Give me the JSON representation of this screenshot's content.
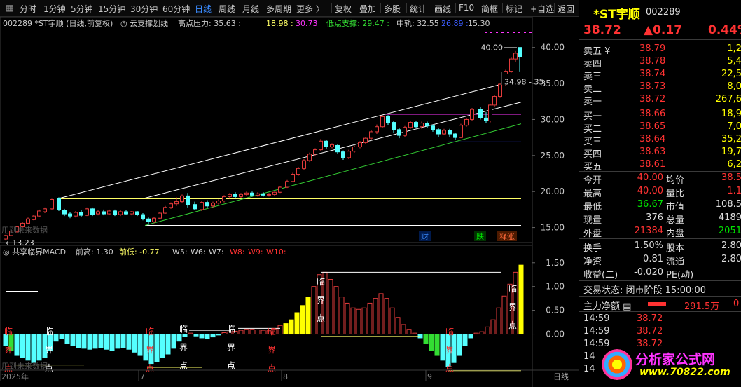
{
  "toolbar": {
    "left_items": [
      "分时",
      "1分钟",
      "5分钟",
      "15分钟",
      "30分钟",
      "60分钟",
      "日线",
      "周线",
      "月线",
      "多周期",
      "更多 〉"
    ],
    "active_item": "日线",
    "right_items": [
      "复权",
      "叠加",
      "多股",
      "统计",
      "画线",
      "F10",
      "简框",
      "标记",
      "+自选",
      "返回"
    ]
  },
  "main_chart": {
    "info": {
      "code": "002289",
      "name": "*ST宇顺",
      "period": "(日线,前复权)",
      "indicator_name": "云支撑划线",
      "high_pressure_label": "高点压力:",
      "high_pressure_values": [
        "35.63",
        "18.98",
        "30.73"
      ],
      "low_support_label": "低点支撑:",
      "low_support_value": "29.47",
      "mid_rail_label": "中轨:",
      "mid_rail_values": [
        "32.55",
        "26.89",
        "15.30"
      ]
    },
    "y_ticks": [
      "40.00",
      "35.00",
      "30.00",
      "25.00",
      "20.00",
      "15.00"
    ],
    "y_range": [
      13.5,
      42.5
    ],
    "annotations": {
      "top_price": "40.00",
      "channel_label": "34.98 - 35",
      "low_price": "←13.23",
      "footer_note": "用到未来数据"
    },
    "badges": [
      {
        "text": "财",
        "color": "#3b8cff"
      },
      {
        "text": "跌",
        "color": "#00e600"
      },
      {
        "text": "释涨",
        "color": "#ff6a3a"
      }
    ],
    "colors": {
      "up": "#e33b3b",
      "down": "#55ffff",
      "boll_upper": "#ffffff",
      "support": "#33cc33",
      "yellow_line": "#ffff66",
      "magenta": "#ff33ff",
      "blue": "#3344ff"
    }
  },
  "sub_chart": {
    "info": {
      "indicator_name": "共享临界MACD",
      "prev_high_label": "前高:",
      "prev_high_value": "1.30",
      "prev_low_label": "前低:",
      "prev_low_value": "-0.77",
      "w_labels": [
        "W5:",
        "W6:",
        "W7:",
        "W8:",
        "W9:",
        "W10:"
      ]
    },
    "y_ticks": [
      "1.50",
      "1.00",
      "0.50",
      "0.00"
    ],
    "y_range": [
      -0.7,
      1.6
    ],
    "footer_note": "用到未来数据",
    "vertical_labels": [
      {
        "chars": [
          "临",
          "界",
          "点"
        ],
        "color": "#ffffff"
      },
      {
        "chars": [
          "临",
          "界",
          "点"
        ],
        "color": "#ff3232"
      }
    ],
    "critical_words": {
      "lin": "临",
      "jie": "界",
      "dian": "点"
    }
  },
  "x_axis": {
    "labels": [
      "2025年",
      "7",
      "8",
      "9"
    ],
    "period_button": "日线"
  },
  "quote_panel": {
    "title": "*ST宇顺",
    "code": "002289",
    "price": "38.72",
    "change": "▲0.17",
    "change_pct": "0.44%",
    "asks": [
      {
        "label": "卖五 ¥",
        "price": "38.79",
        "vol": "1,2"
      },
      {
        "label": "卖四",
        "price": "38.78",
        "vol": "5,4"
      },
      {
        "label": "卖三",
        "price": "38.74",
        "vol": "22,5"
      },
      {
        "label": "卖二",
        "price": "38.73",
        "vol": "8,0"
      },
      {
        "label": "卖一",
        "price": "38.72",
        "vol": "267,6"
      }
    ],
    "bids": [
      {
        "label": "买一",
        "price": "38.66",
        "vol": "18,9"
      },
      {
        "label": "买二",
        "price": "38.65",
        "vol": "7,0"
      },
      {
        "label": "买三",
        "price": "38.64",
        "vol": "35,2"
      },
      {
        "label": "买四",
        "price": "38.63",
        "vol": "19,7"
      },
      {
        "label": "买五",
        "price": "38.61",
        "vol": "6,2"
      }
    ],
    "stats": [
      {
        "l1": "今开",
        "v1": "40.00",
        "c1": "red",
        "l2": "均价",
        "v2": "38.5",
        "c2": "red"
      },
      {
        "l1": "最高",
        "v1": "40.00",
        "c1": "red",
        "l2": "量比",
        "v2": "1.1",
        "c2": "red"
      },
      {
        "l1": "最低",
        "v1": "36.67",
        "c1": "green",
        "l2": "市值",
        "v2": "108.5",
        "c2": "white"
      },
      {
        "l1": "现量",
        "v1": "376",
        "c1": "white",
        "l2": "总量",
        "v2": "4189",
        "c2": "white"
      },
      {
        "l1": "外盘",
        "v1": "21384",
        "c1": "red",
        "l2": "内盘",
        "v2": "2051",
        "c2": "green"
      }
    ],
    "stats2": [
      {
        "l1": "换手",
        "v1": "1.50%",
        "l2": "股本",
        "v2": "2.80"
      },
      {
        "l1": "净资",
        "v1": "0.81",
        "l2": "流通",
        "v2": "2.80"
      },
      {
        "l1": "收益(二)",
        "v1": "-0.020",
        "l2": "PE(动)",
        "v2": ""
      }
    ],
    "trade_status_label": "交易状态:",
    "trade_status_value": "闭市阶段 15:00:00",
    "main_net_label": "主力净额",
    "main_net_value": "291.5万",
    "main_net_extra": "0",
    "ticks": [
      {
        "time": "14:59",
        "price": "38.72"
      },
      {
        "time": "14:59",
        "price": "38.72"
      },
      {
        "time": "14:59",
        "price": "38.72"
      },
      {
        "time": "14",
        "price": ""
      },
      {
        "time": "14",
        "price": ""
      }
    ],
    "watermark": {
      "text": "分析家公式网",
      "url": "www.70822.com"
    }
  }
}
